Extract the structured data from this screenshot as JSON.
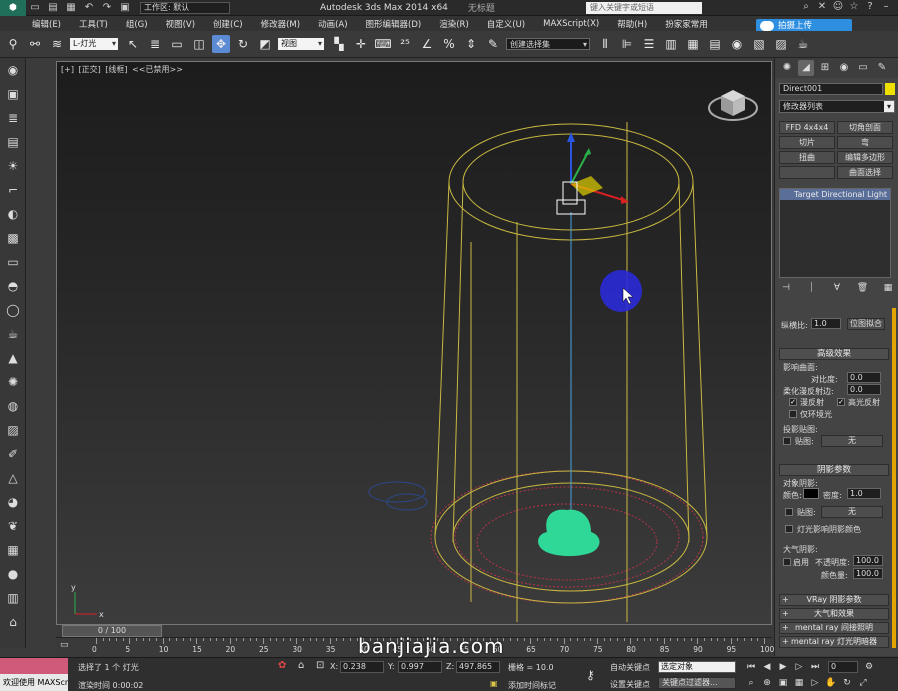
{
  "titlebar": {
    "workspace_label": "工作区: 默认",
    "app_title": "Autodesk 3ds Max  2014 x64",
    "doc_title": "无标题",
    "search_placeholder": "键入关键字或短语"
  },
  "menubar": {
    "items": [
      "编辑(E)",
      "工具(T)",
      "组(G)",
      "视图(V)",
      "创建(C)",
      "修改器(M)",
      "动画(A)",
      "图形编辑器(D)",
      "渲染(R)",
      "自定义(U)",
      "MAXScript(X)",
      "帮助(H)",
      "扮家家常用"
    ],
    "upload_button": "拍摄上传"
  },
  "toolbar": {
    "filter_label": "L-灯光",
    "coord_label": "视图",
    "selection_set_label": "创建选择集"
  },
  "viewport": {
    "label_parts": [
      "[+]",
      "[正交]",
      "[线框]",
      "<<已禁用>>"
    ],
    "axis_labels": {
      "x": "x",
      "y": "y"
    }
  },
  "command_panel": {
    "object_name": "Direct001",
    "object_color": "#f0e000",
    "modifier_list_label": "修改器列表",
    "modifier_buttons": [
      "FFD 4x4x4",
      "切角剖面",
      "切片",
      "弯",
      "扭曲",
      "编辑多边形",
      "",
      "曲面选择"
    ],
    "stack_item": "Target Directional Light",
    "aspect_label": "纵横比:",
    "aspect_value": "1.0",
    "bitmap_fit_button": "位图拟合",
    "advanced_effects": {
      "title": "高级效果",
      "affect_surfaces_label": "影响曲面:",
      "contrast_label": "对比度:",
      "contrast_value": "0.0",
      "soften_label": "柔化漫反射边:",
      "soften_value": "0.0",
      "diffuse_label": "漫反射",
      "specular_label": "高光反射",
      "ambient_only_label": "仅环境光",
      "projector_map_label": "投影贴图:",
      "map_label": "贴图:",
      "none_label": "无"
    },
    "shadow_params": {
      "title": "阴影参数",
      "object_shadows_label": "对象阴影:",
      "color_label": "颜色:",
      "density_label": "密度:",
      "density_value": "1.0",
      "map_label": "贴图:",
      "none_label": "无",
      "light_affects_label": "灯光影响阴影颜色",
      "atmosphere_label": "大气阴影:",
      "enable_label": "启用",
      "opacity_label": "不透明度:",
      "opacity_value": "100.0",
      "color_amount_label": "颜色量:",
      "color_amount_value": "100.0"
    },
    "collapsed_rollouts": [
      "VRay 阴影参数",
      "大气和效果",
      "mental ray 间接照明",
      "mental ray 灯光明暗器"
    ]
  },
  "timeline": {
    "frame_display": "0 / 100",
    "ticks": [
      "0",
      "5",
      "10",
      "15",
      "20",
      "25",
      "30",
      "35",
      "40",
      "45",
      "50",
      "55",
      "60",
      "65",
      "70",
      "75",
      "80",
      "85",
      "90",
      "95",
      "100"
    ]
  },
  "statusbar": {
    "welcome": "欢迎使用 MAXScr",
    "selection_status": "选择了 1 个 灯光",
    "render_time": "渲染时间  0:00:02",
    "x_label": "X:",
    "x_value": "0.238",
    "y_label": "Y:",
    "y_value": "0.997",
    "z_label": "Z:",
    "z_value": "497.865",
    "grid": "栅格 = 10.0",
    "add_time_tag": "添加时间标记",
    "auto_key": "自动关键点",
    "set_key": "设置关键点",
    "selected_object": "选定对象",
    "key_filters": "关键点过滤器...",
    "frame_value": "0"
  },
  "watermark": "banjiajia.com"
}
